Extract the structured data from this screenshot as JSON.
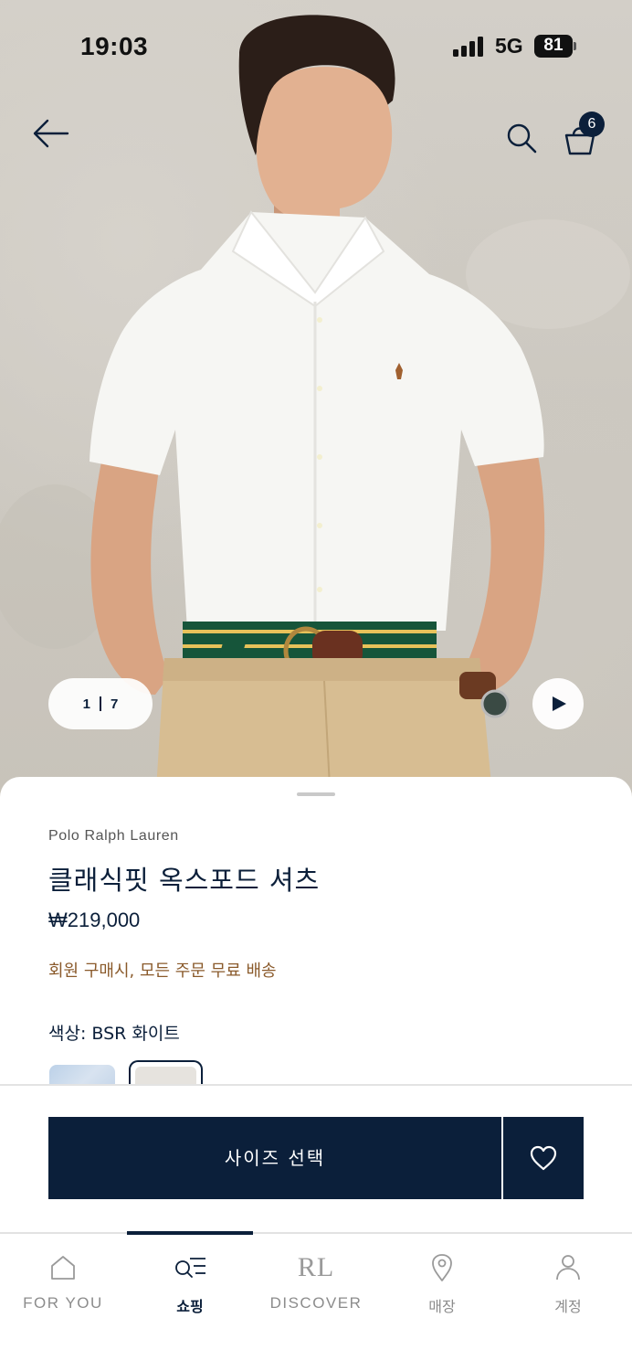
{
  "status_bar": {
    "time": "19:03",
    "network": "5G",
    "battery": "81"
  },
  "header": {
    "back_icon": "arrow-left-icon",
    "search_icon": "search-icon",
    "bag_icon": "shopping-bag-icon",
    "bag_count": "6"
  },
  "gallery": {
    "current": "1",
    "total": "7",
    "play_icon": "play-icon"
  },
  "product": {
    "brand": "Polo Ralph Lauren",
    "name": "클래식핏 옥스포드 셔츠",
    "price": "₩219,000",
    "promo": "회원 구매시, 모든 주문 무료 배송",
    "color_label": "색상:  BSR 화이트",
    "swatches": [
      "light-blue",
      "white"
    ],
    "selected_swatch": "white"
  },
  "actions": {
    "size_select_label": "사이즈 선택",
    "wishlist_icon": "heart-icon"
  },
  "tabbar": {
    "items": [
      {
        "label": "FOR YOU",
        "icon": "home-icon",
        "active": false
      },
      {
        "label": "쇼핑",
        "icon": "shopping-search-icon",
        "active": true
      },
      {
        "label": "DISCOVER",
        "icon": "rl-monogram-icon",
        "monogram": "RL",
        "active": false
      },
      {
        "label": "매장",
        "icon": "location-pin-icon",
        "active": false
      },
      {
        "label": "계정",
        "icon": "person-icon",
        "active": false
      }
    ]
  },
  "colors": {
    "navy": "#0b1f3a",
    "promo_brown": "#8a5a2b",
    "inactive_gray": "#8c8c8c"
  }
}
